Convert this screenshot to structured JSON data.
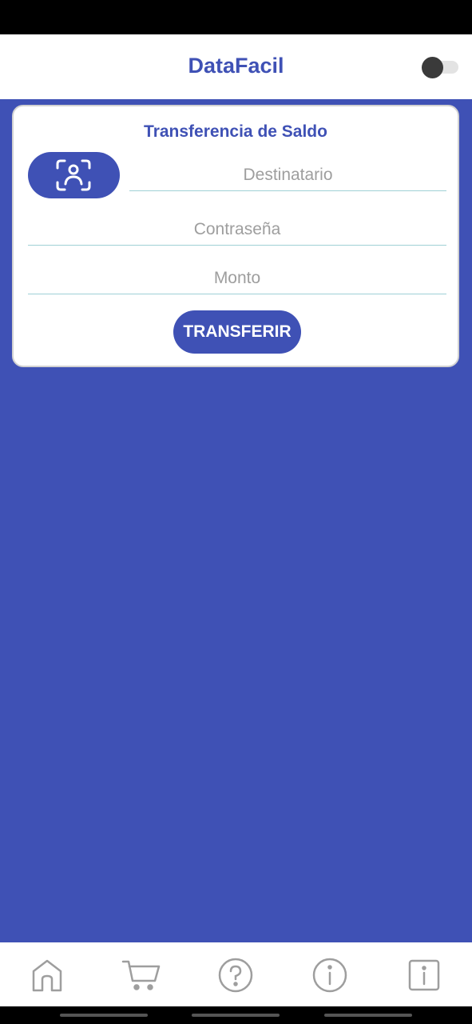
{
  "header": {
    "title": "DataFacil",
    "theme_toggle_on": false
  },
  "transfer_card": {
    "title": "Transferencia de Saldo",
    "recipient_placeholder": "Destinatario",
    "password_placeholder": "Contraseña",
    "amount_placeholder": "Monto",
    "submit_label": "TRANSFERIR"
  },
  "bottom_nav": {
    "items": [
      {
        "icon": "home-icon"
      },
      {
        "icon": "cart-icon"
      },
      {
        "icon": "help-icon"
      },
      {
        "icon": "info-icon"
      },
      {
        "icon": "info-square-icon"
      }
    ]
  },
  "colors": {
    "primary": "#3f51b5",
    "surface": "#ffffff",
    "underline": "#9fd0d6",
    "placeholder": "#9e9e9e"
  }
}
